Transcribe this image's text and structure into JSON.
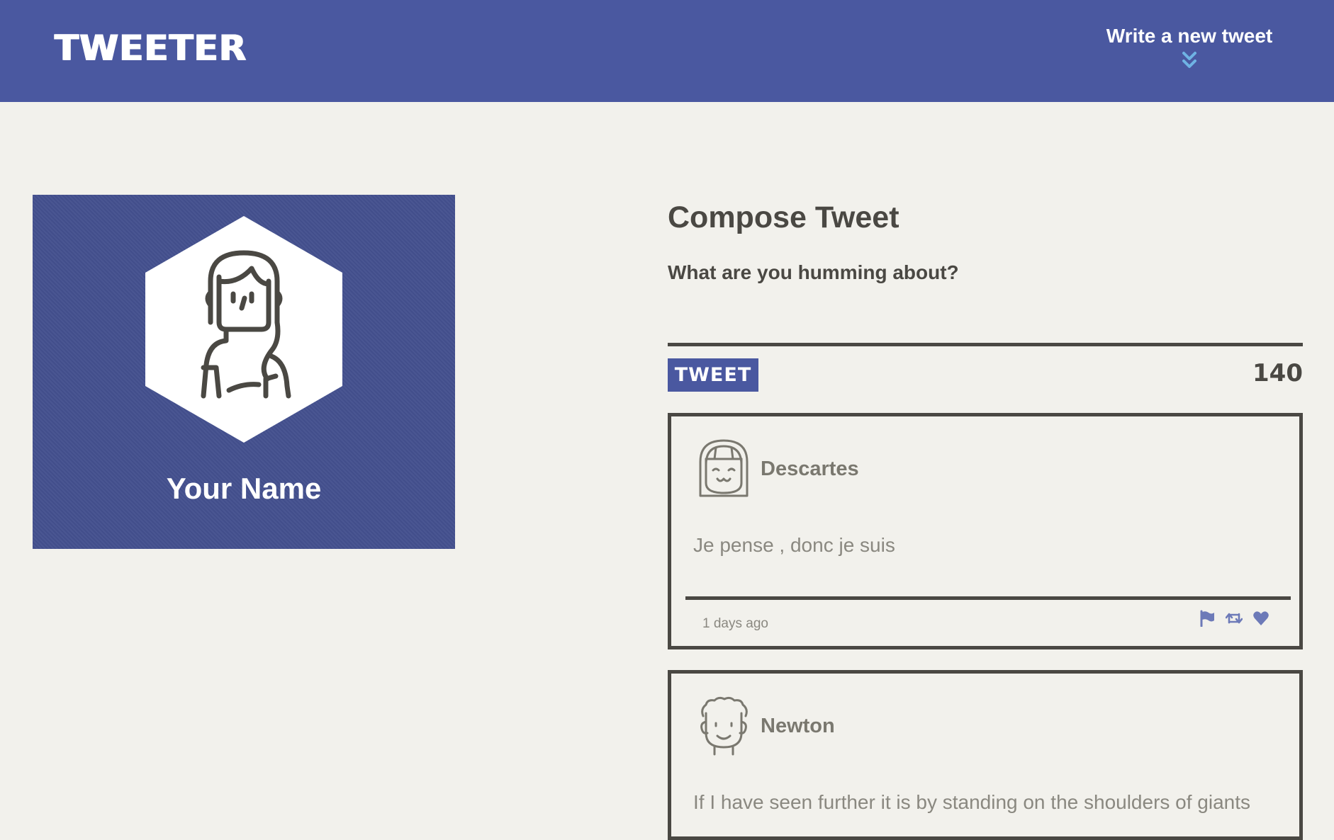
{
  "header": {
    "brand": "TWEETER",
    "compose_toggle_label": "Write a new tweet",
    "compose_toggle_icon": "double-chevron-down-icon"
  },
  "colors": {
    "brand": "#4a58a0",
    "background": "#f2f1ec",
    "text": "#4a4843",
    "accent_icon": "#6fb3e4",
    "action_icons": "#6d7ab8"
  },
  "profile": {
    "avatar_icon": "woman-avatar-icon",
    "name": "Your Name"
  },
  "compose": {
    "title": "Compose Tweet",
    "prompt": "What are you humming about?",
    "textarea_value": "",
    "button_label": "TWEET",
    "counter": "140"
  },
  "tweets": [
    {
      "avatar_icon": "girl-avatar-icon",
      "author": "Descartes",
      "text": "Je pense , donc je suis",
      "time": "1 days ago",
      "actions": [
        "flag-icon",
        "retweet-icon",
        "heart-icon"
      ]
    },
    {
      "avatar_icon": "man-avatar-icon",
      "author": "Newton",
      "text": "If I have seen further it is by standing on the shoulders of giants"
    }
  ]
}
